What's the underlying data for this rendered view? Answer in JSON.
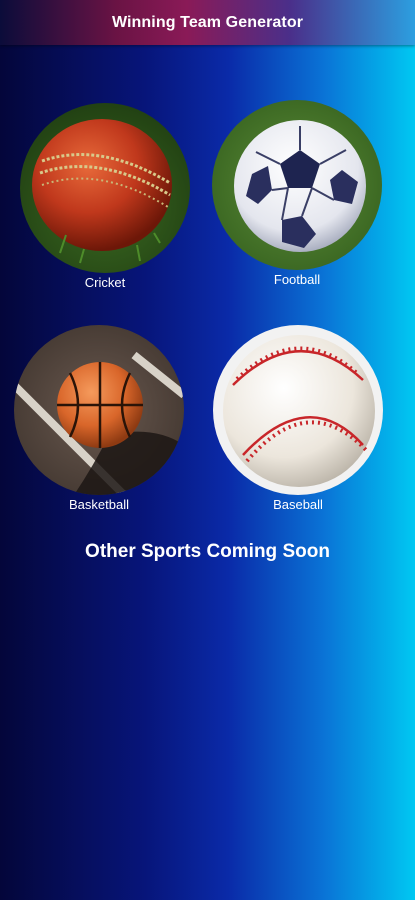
{
  "app": {
    "title": "Winning Team Generator"
  },
  "sports": {
    "cricket": {
      "label": "Cricket",
      "icon": "cricket-ball-icon"
    },
    "football": {
      "label": "Football",
      "icon": "soccer-ball-icon"
    },
    "basketball": {
      "label": "Basketball",
      "icon": "basketball-icon"
    },
    "baseball": {
      "label": "Baseball",
      "icon": "baseball-icon"
    }
  },
  "footer_message": "Other Sports Coming Soon",
  "colors": {
    "accent_pink": "#8a1a57",
    "accent_cyan": "#00c8f2",
    "deep_navy": "#04063a"
  }
}
